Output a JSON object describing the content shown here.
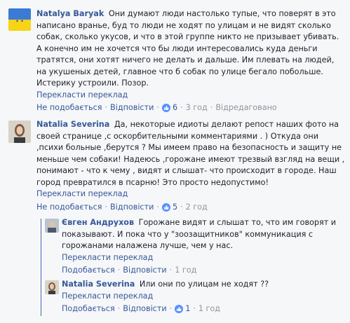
{
  "comments": [
    {
      "author": "Natalya Baryak",
      "text": "Они думают люди настолько тупые, что поверят в это написано вранье, буд то люди не ходят по улицам и не видят сколько собак, сколько укусов, и что в этой группе никто не призывает убивать. А конечно им не хочется что бы люди интересовались куда деньги тратятся, они хотят ничего не делать и дальше. Им плевать на людей, на укушеных детей, главное что б собак по улице бегало побольше. Истерику устроили. Позор.",
      "translate": "Перекласти переклад",
      "like": "Не подобається",
      "reply": "Відповісти",
      "reactions": "6",
      "time": "3 год",
      "edited": "Відредаговано"
    },
    {
      "author": "Natalia Severina",
      "text": "Да, некоторые идиоты делают репост наших фото на своей странице ,с оскорбительными комментариями . ) Откуда они ,психи больные ,берутся ? Мы имеем право на безопасность и защиту не меньше чем собаки! Надеюсь ,горожане имеют трезвый взгляд на вещи , понимают - что к чему , видят и слышат- что происходит в городе. Наш город превратился в псарню! Это просто недопустимо!",
      "translate": "Перекласти переклад",
      "like": "Не подобається",
      "reply": "Відповісти",
      "reactions": "5",
      "time": "2 год"
    },
    {
      "author": "Євген Андрухов",
      "text": "Горожане видят и слышат то, что им говорят и показывают. И пока что у \"зоозащитников\" коммуникация с горожанами налажена лучше, чем у нас.",
      "translate": "Перекласти переклад",
      "like": "Подобається",
      "reply": "Відповісти",
      "time": "1 год"
    },
    {
      "author": "Natalia Severina",
      "text": "Или они по улицам не ходят ??",
      "translate": "Перекласти переклад",
      "like": "Подобається",
      "reply": "Відповісти",
      "reactions": "1",
      "time": "1 год"
    }
  ],
  "colors": {
    "link": "#365899",
    "meta": "#90949c",
    "reaction": "#5890ff",
    "reply_line": "#4267b2"
  },
  "icons": [
    "like-thumb-icon",
    "flag-avatar",
    "portrait-avatar"
  ]
}
